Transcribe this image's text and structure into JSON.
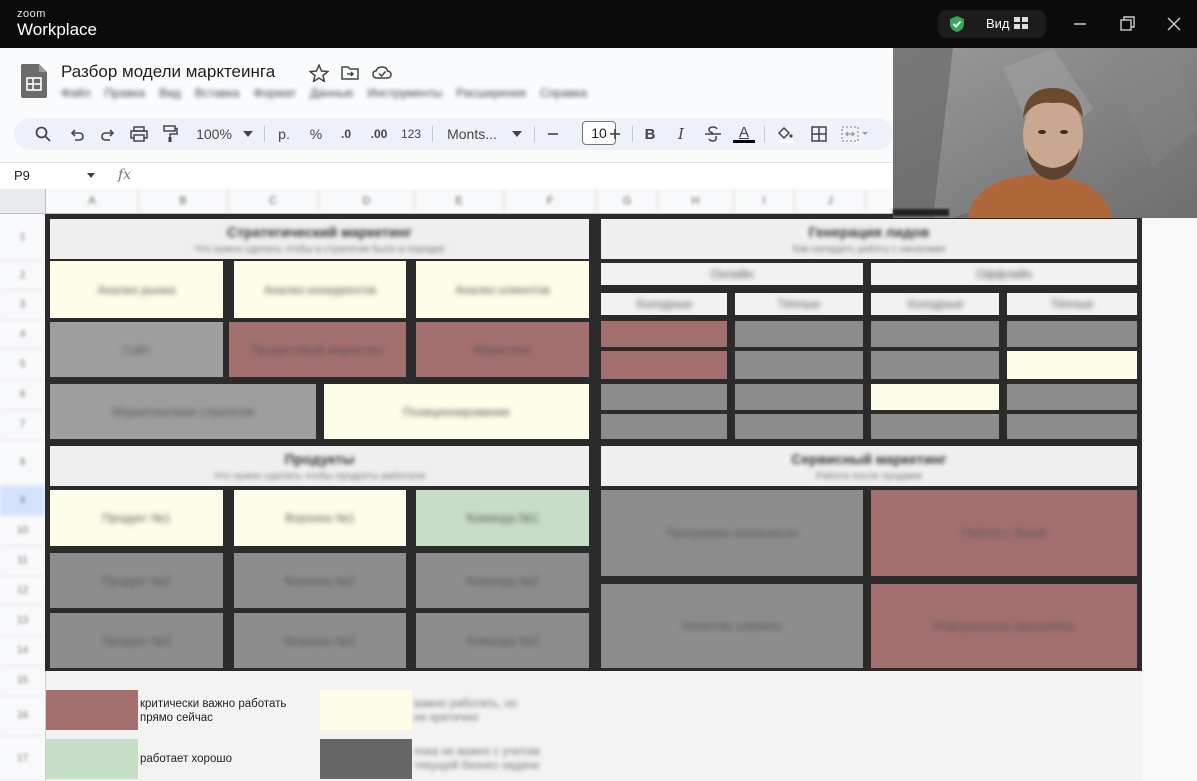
{
  "zoom": {
    "brand_small": "zoom",
    "brand_big": "Workplace",
    "view_label": "Вид",
    "icons": [
      "shield-check-icon",
      "grid-view-icon",
      "minimize-icon",
      "restore-icon",
      "close-icon"
    ]
  },
  "sheets": {
    "doc_title": "Разбор модели марктеинга",
    "title_icons": [
      "star-icon",
      "move-to-folder-icon",
      "cloud-status-icon"
    ],
    "menu": [
      "Файл",
      "Правка",
      "Вид",
      "Вставка",
      "Формат",
      "Данные",
      "Инструменты",
      "Расширения",
      "Справка"
    ],
    "toolbar": {
      "zoom": "100%",
      "currency": "р.",
      "percent": "%",
      "dec_decrease": ".0",
      "dec_increase": ".00",
      "number_format": "123",
      "font": "Monts...",
      "font_size": "10",
      "bold": "B",
      "italic": "I",
      "text_color": "A",
      "icons": [
        "search-icon",
        "undo-icon",
        "redo-icon",
        "print-icon",
        "paint-format-icon",
        "strikethrough-icon",
        "fill-color-icon",
        "borders-icon",
        "merge-cells-icon"
      ]
    },
    "name_box": "P9",
    "fx": "fx",
    "columns": [
      "A",
      "B",
      "C",
      "D",
      "E",
      "F",
      "G",
      "H",
      "I",
      "J"
    ],
    "rows": [
      "1",
      "2",
      "3",
      "4",
      "5",
      "6",
      "7",
      "8",
      "9",
      "10",
      "11",
      "12",
      "13",
      "14",
      "15",
      "16",
      "17"
    ]
  },
  "board": {
    "strategic_title": "Стратегический маркетинг",
    "strategic_sub": "Что нужно сделать чтобы в стратегии было в порядке",
    "leads_title": "Генерация лидов",
    "leads_sub": "Как наладить работу с каналами",
    "products_title": "Продукты",
    "products_sub": "Что нужно сделать чтобы продукты работали",
    "service_title": "Сервисный маркетинг",
    "service_sub": "Работа после продажи",
    "cells": {
      "c_a1": "Анализ рынка",
      "c_a2": "Анализ конкурентов",
      "c_a3": "Анализ клиентов",
      "c_b1": "Сайт",
      "c_b2": "Продуктовый маркетинг",
      "c_b3": "Маркетинг",
      "c_c1": "Маркетинговая стратегия",
      "c_c2": "Позиционирование",
      "lead_h1": "Онлайн",
      "lead_h2": "Оффлайн",
      "lead_s1": "Холодные",
      "lead_s2": "Тёплые",
      "lead_s3": "Холодные",
      "lead_s4": "Тёплые",
      "p_r1c1": "Продукт №1",
      "p_r1c2": "Воронка №1",
      "p_r1c3": "Команда №1",
      "p_r2c1": "Продукт №2",
      "p_r2c2": "Воронка №2",
      "p_r2c3": "Команда №2",
      "p_r3c1": "Продукт №3",
      "p_r3c2": "Воронка №3",
      "p_r3c3": "Команда №3",
      "s_1": "Программа лояльности",
      "s_2": "Работа с базой",
      "s_3": "Качество сервиса",
      "s_4": "Реферальная программа"
    }
  },
  "legend": {
    "critical": "критически важно работать\nпрямо сейчас",
    "important": "важно работать, но\nне критично",
    "good": "работает хорошо",
    "not_important": "пока не важно с учетом\nтекущей бизнес-задачи"
  },
  "colors": {
    "critical": "#a46f6f",
    "important": "#fefee8",
    "good": "#c6ddc6",
    "not_important": "#8d8d8d"
  }
}
